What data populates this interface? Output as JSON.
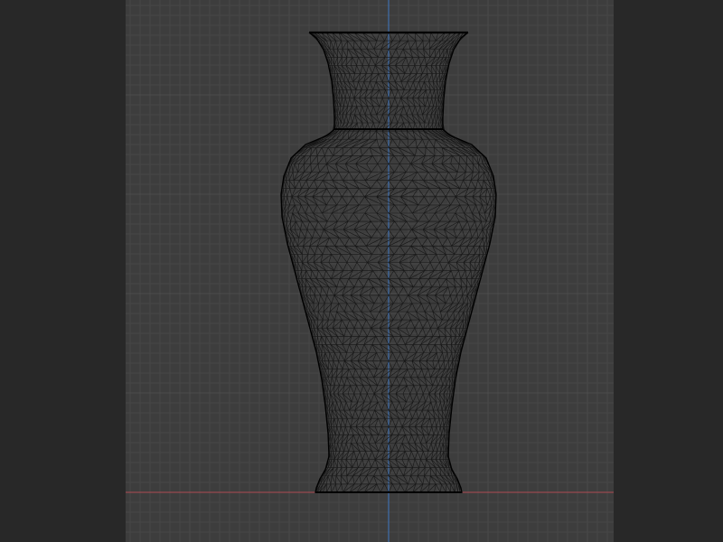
{
  "viewport": {
    "view": "front-orthographic",
    "shading": "wireframe",
    "object": "vase-mesh"
  },
  "colors": {
    "background": "#282828",
    "viewport_bg": "#3d3d3d",
    "grid_minor": "#464646",
    "grid_major": "#4c4c4c",
    "axis_x": "#b04a52",
    "axis_z": "#3f78c2",
    "wire": "#111111",
    "wire_outline": "#000000"
  }
}
